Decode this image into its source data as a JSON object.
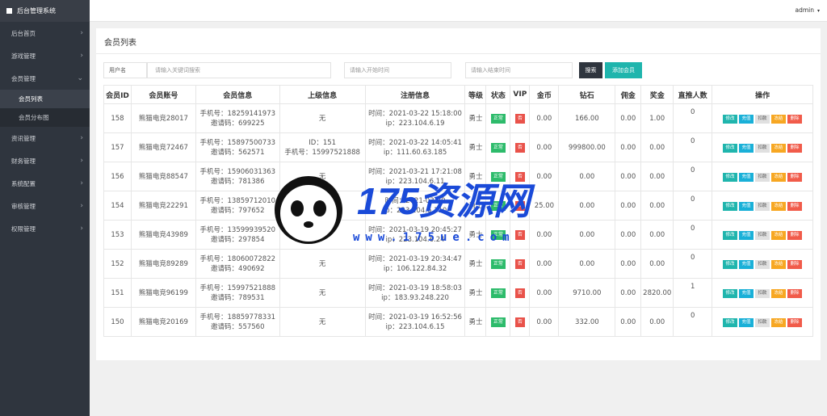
{
  "sidebar": {
    "brand": "后台管理系统",
    "items": [
      {
        "label": "后台首页",
        "chev": "›"
      },
      {
        "label": "游戏管理",
        "chev": "›"
      },
      {
        "label": "会员管理",
        "chev": "⌄"
      },
      {
        "label": "会员列表",
        "sub": true,
        "active": true
      },
      {
        "label": "会员分布图",
        "sub": true
      },
      {
        "label": "资讯管理",
        "chev": "›"
      },
      {
        "label": "财务管理",
        "chev": "›"
      },
      {
        "label": "系统配置",
        "chev": "›"
      },
      {
        "label": "审核管理",
        "chev": "›"
      },
      {
        "label": "权限管理",
        "chev": "›"
      }
    ]
  },
  "topbar": {
    "user": "admin",
    "caret": "▾"
  },
  "card": {
    "title": "会员列表"
  },
  "filter": {
    "label": "用户名",
    "keyword_placeholder": "请输入关键词搜索",
    "start_placeholder": "请输入开始时间",
    "end_placeholder": "请输入结束时间",
    "search": "搜索",
    "add": "添加会员"
  },
  "table": {
    "headers": [
      "会员ID",
      "会员账号",
      "会员信息",
      "上级信息",
      "注册信息",
      "等级",
      "状态",
      "VIP",
      "金币",
      "钻石",
      "佣金",
      "奖金",
      "直推人数",
      "操作"
    ],
    "actions": [
      "修改",
      "充值",
      "扣款",
      "冻结",
      "删除"
    ],
    "rows": [
      {
        "id": "158",
        "account": "熊猫电竞28017",
        "info1": "手机号：18259141973",
        "info2": "邀请码：699225",
        "parent1": "无",
        "parent2": "",
        "reg1": "时间：2021-03-22 15:18:00",
        "reg2": "ip：223.104.6.19",
        "level": "勇士",
        "status": "正常",
        "vip": "否",
        "gold": "0.00",
        "diamond": "166.00",
        "commission": "0.00",
        "bonus": "1.00",
        "direct": "0"
      },
      {
        "id": "157",
        "account": "熊猫电竞72467",
        "info1": "手机号：15897500733",
        "info2": "邀请码：562571",
        "parent1": "ID：151",
        "parent2": "手机号：15997521888",
        "reg1": "时间：2021-03-22 14:05:41",
        "reg2": "ip：111.60.63.185",
        "level": "勇士",
        "status": "正常",
        "vip": "否",
        "gold": "0.00",
        "diamond": "999800.00",
        "commission": "0.00",
        "bonus": "0.00",
        "direct": "0"
      },
      {
        "id": "156",
        "account": "熊猫电竞88547",
        "info1": "手机号：15906031363",
        "info2": "邀请码：781386",
        "parent1": "无",
        "parent2": "",
        "reg1": "时间：2021-03-21 17:21:08",
        "reg2": "ip：223.104.6.11",
        "level": "勇士",
        "status": "正常",
        "vip": "否",
        "gold": "0.00",
        "diamond": "0.00",
        "commission": "0.00",
        "bonus": "0.00",
        "direct": "0"
      },
      {
        "id": "154",
        "account": "熊猫电竞22291",
        "info1": "手机号：13859712010",
        "info2": "邀请码：797652",
        "parent1": "无",
        "parent2": "",
        "reg1": "时间：2021-03-20",
        "reg2": "ip：223.104.6.110",
        "level": "勇士",
        "status": "正常",
        "vip": "否",
        "gold": "25.00",
        "diamond": "0.00",
        "commission": "0.00",
        "bonus": "0.00",
        "direct": "0"
      },
      {
        "id": "153",
        "account": "熊猫电竞43989",
        "info1": "手机号：13599939520",
        "info2": "邀请码：297854",
        "parent1": "无",
        "parent2": "",
        "reg1": "时间：2021-03-19 20:45:27",
        "reg2": "ip：223.104.6.24",
        "level": "勇士",
        "status": "正常",
        "vip": "否",
        "gold": "0.00",
        "diamond": "0.00",
        "commission": "0.00",
        "bonus": "0.00",
        "direct": "0"
      },
      {
        "id": "152",
        "account": "熊猫电竞89289",
        "info1": "手机号：18060072822",
        "info2": "邀请码：490692",
        "parent1": "无",
        "parent2": "",
        "reg1": "时间：2021-03-19 20:34:47",
        "reg2": "ip：106.122.84.32",
        "level": "勇士",
        "status": "正常",
        "vip": "否",
        "gold": "0.00",
        "diamond": "0.00",
        "commission": "0.00",
        "bonus": "0.00",
        "direct": "0"
      },
      {
        "id": "151",
        "account": "熊猫电竞96199",
        "info1": "手机号：15997521888",
        "info2": "邀请码：789531",
        "parent1": "无",
        "parent2": "",
        "reg1": "时间：2021-03-19 18:58:03",
        "reg2": "ip：183.93.248.220",
        "level": "勇士",
        "status": "正常",
        "vip": "否",
        "gold": "0.00",
        "diamond": "9710.00",
        "commission": "0.00",
        "bonus": "2820.00",
        "direct": "1"
      },
      {
        "id": "150",
        "account": "熊猫电竞20169",
        "info1": "手机号：18859778331",
        "info2": "邀请码：557560",
        "parent1": "无",
        "parent2": "",
        "reg1": "时间：2021-03-19 16:52:56",
        "reg2": "ip：223.104.6.15",
        "level": "勇士",
        "status": "正常",
        "vip": "否",
        "gold": "0.00",
        "diamond": "332.00",
        "commission": "0.00",
        "bonus": "0.00",
        "direct": "0"
      }
    ]
  },
  "watermark": {
    "text": "175资源网",
    "url": "www.175ue.com"
  }
}
